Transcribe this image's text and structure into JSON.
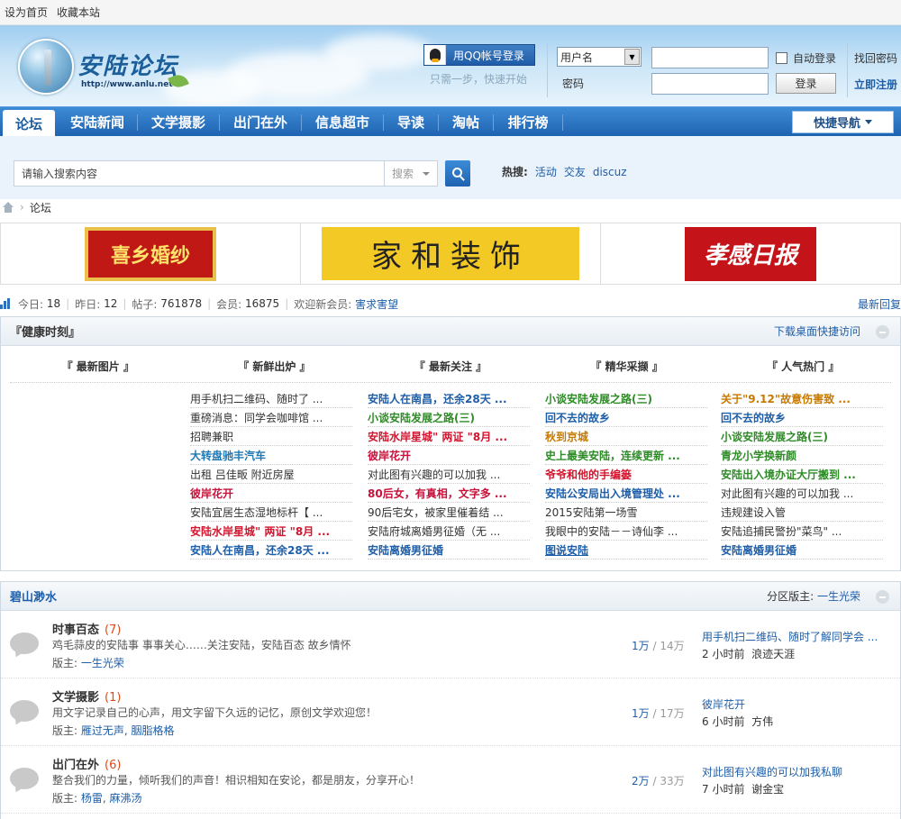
{
  "topbar": {
    "set_home": "设为首页",
    "bookmark": "收藏本站"
  },
  "header": {
    "logo_text": "安陆论坛",
    "logo_url": "http://www.anlu.net",
    "qq_login": "用QQ帐号登录",
    "qq_note": "只需一步，快速开始",
    "username_select": "用户名",
    "password_label": "密码",
    "auto_login": "自动登录",
    "login_button": "登录",
    "forgot_password": "找回密码",
    "register": "立即注册"
  },
  "nav": {
    "items": [
      "论坛",
      "安陆新闻",
      "文学摄影",
      "出门在外",
      "信息超市",
      "导读",
      "淘帖",
      "排行榜"
    ],
    "quick_nav": "快捷导航"
  },
  "search": {
    "placeholder": "请输入搜索内容",
    "type": "搜索",
    "hot_label": "热搜:",
    "hot_items": [
      "活动",
      "交友",
      "discuz"
    ]
  },
  "breadcrumb": {
    "current": "论坛"
  },
  "ads": [
    "喜乡婚纱",
    "家和装饰",
    "孝感日报"
  ],
  "stats": {
    "today_label": "今日:",
    "today": "18",
    "yesterday_label": "昨日:",
    "yesterday": "12",
    "posts_label": "帖子:",
    "posts": "761878",
    "members_label": "会员:",
    "members": "16875",
    "newest_label": "欢迎新会员:",
    "newest": "害求害望",
    "latest_reply": "最新回复"
  },
  "health": {
    "title": "『健康时刻』",
    "right_link": "下载桌面快捷访问",
    "tabs": [
      "『 最新图片 』",
      "『 新鲜出炉 』",
      "『 最新关注 』",
      "『 精华采撷 』",
      "『 人气热门 』"
    ],
    "columns": [
      [
        {
          "t": "用手机扫二维码、随时了 ...",
          "c": "dark"
        },
        {
          "t": "重磅消息：同学会咖啡馆 ...",
          "c": "dark"
        },
        {
          "t": "招聘兼职",
          "c": "dark"
        },
        {
          "t": "大转盘驰丰汽车",
          "c": "teal b"
        },
        {
          "t": "出租 吕佳畈 附近房屋",
          "c": "dark"
        },
        {
          "t": "彼岸花开",
          "c": "crimson b"
        },
        {
          "t": "安陆宜居生态湿地标杆【 ...",
          "c": "dark"
        },
        {
          "t": "安陆水岸星城\" 两证 \"8月 ...",
          "c": "red b"
        },
        {
          "t": "安陆人在南昌，还余28天 ...",
          "c": "blue b"
        }
      ],
      [
        {
          "t": "安陆人在南昌，还余28天 ...",
          "c": "blue b"
        },
        {
          "t": "小谈安陆发展之路(三)",
          "c": "green b"
        },
        {
          "t": "安陆水岸星城\" 两证 \"8月 ...",
          "c": "red b"
        },
        {
          "t": "彼岸花开",
          "c": "crimson b"
        },
        {
          "t": "对此图有兴趣的可以加我 ...",
          "c": "dark"
        },
        {
          "t": "80后女，有真相，文字多 ...",
          "c": "crimson b"
        },
        {
          "t": "90后宅女，被家里催着结 ...",
          "c": "dark"
        },
        {
          "t": "安陆府城离婚男征婚（无 ...",
          "c": "dark"
        },
        {
          "t": "安陆离婚男征婚",
          "c": "blue b"
        }
      ],
      [
        {
          "t": "小谈安陆发展之路(三)",
          "c": "green b"
        },
        {
          "t": "回不去的故乡",
          "c": "blue b"
        },
        {
          "t": "秋到京城",
          "c": "orange b"
        },
        {
          "t": "史上最美安陆，连续更新 ...",
          "c": "green b"
        },
        {
          "t": "爷爷和他的手编篓",
          "c": "red b"
        },
        {
          "t": "安陆公安局出入境管理处 ...",
          "c": "blue b"
        },
        {
          "t": "2015安陆第一场雪",
          "c": "dark"
        },
        {
          "t": "我眼中的安陆－－诗仙李 ...",
          "c": "dark"
        },
        {
          "t": "图说安陆",
          "c": "blue b u"
        }
      ],
      [
        {
          "t": "关于\"9.12\"故意伤害致 ...",
          "c": "orange b"
        },
        {
          "t": "回不去的故乡",
          "c": "blue b"
        },
        {
          "t": "小谈安陆发展之路(三)",
          "c": "green b"
        },
        {
          "t": "青龙小学换新颜",
          "c": "green b"
        },
        {
          "t": "安陆出入境办证大厅搬到 ...",
          "c": "green b"
        },
        {
          "t": "对此图有兴趣的可以加我 ...",
          "c": "dark"
        },
        {
          "t": "违规建设入管",
          "c": "dark"
        },
        {
          "t": "安陆追捕民警扮\"菜鸟\" ...",
          "c": "dark"
        },
        {
          "t": "安陆离婚男征婚",
          "c": "blue b"
        }
      ]
    ]
  },
  "section": {
    "title": "碧山渺水",
    "mods_label": "分区版主:",
    "mods": "一生光荣",
    "forums": [
      {
        "name": "时事百态",
        "today": "(7)",
        "desc": "鸡毛蒜皮的安陆事 事事关心……关注安陆，安陆百态 故乡情怀",
        "mod_label": "版主:",
        "mods": "一生光荣",
        "threads": "1万",
        "posts": "/ 14万",
        "last_title": "用手机扫二维码、随时了解同学会 ...",
        "last_time": "2 小时前",
        "last_user": "浪迹天涯"
      },
      {
        "name": "文学摄影",
        "today": "(1)",
        "desc": "用文字记录自己的心声，用文字留下久远的记忆，原创文学欢迎您！",
        "mod_label": "版主:",
        "mods": "雁过无声, 胭脂格格",
        "threads": "1万",
        "posts": "/ 17万",
        "last_title": "彼岸花开",
        "last_time": "6 小时前",
        "last_user": "方伟"
      },
      {
        "name": "出门在外",
        "today": "(6)",
        "desc": "整合我们的力量，倾听我们的声音！相识相知在安论，都是朋友，分享开心！",
        "mod_label": "版主:",
        "mods": "杨雷, 麻沸汤",
        "threads": "2万",
        "posts": "/ 33万",
        "last_title": "对此图有兴趣的可以加我私聊",
        "last_time": "7 小时前",
        "last_user": "谢金宝"
      }
    ]
  }
}
